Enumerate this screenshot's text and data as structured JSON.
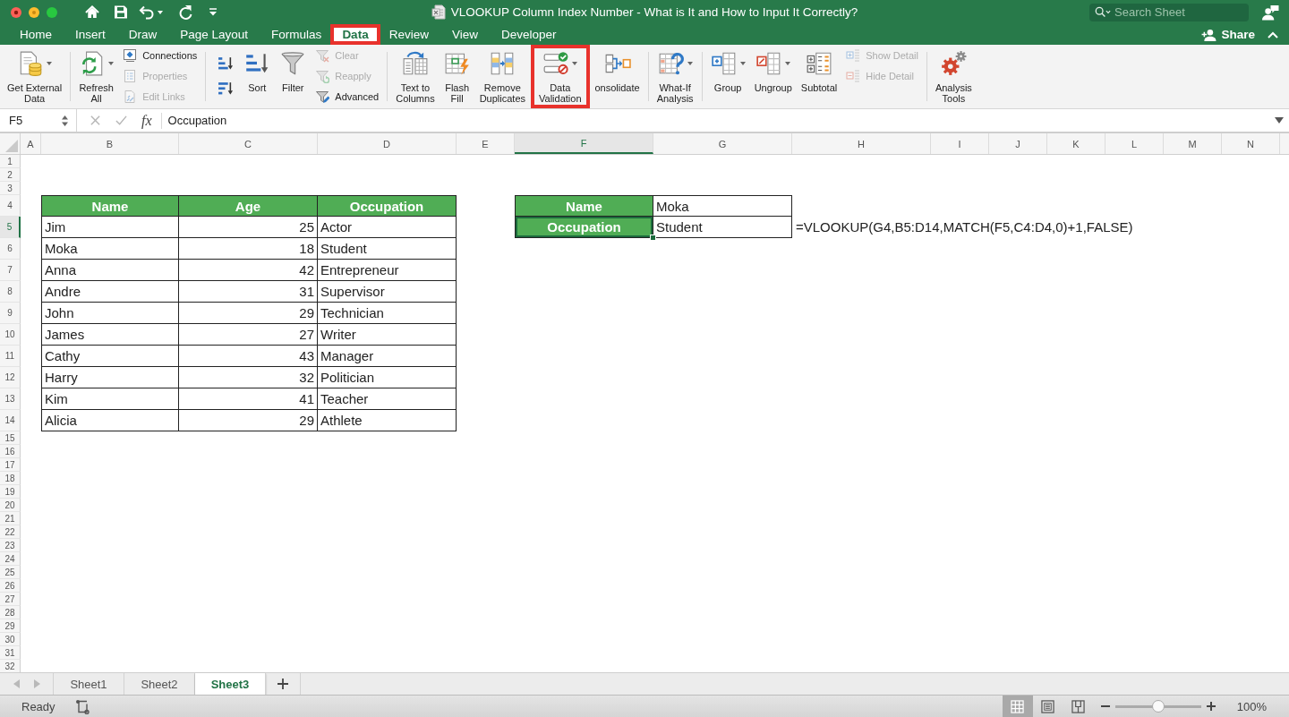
{
  "window": {
    "title": "VLOOKUP Column Index Number - What is It and How to Input It Correctly?"
  },
  "search": {
    "placeholder": "Search Sheet"
  },
  "ribbon_tabs": [
    {
      "label": "Home",
      "selected": false,
      "highlighted": false
    },
    {
      "label": "Insert",
      "selected": false,
      "highlighted": false
    },
    {
      "label": "Draw",
      "selected": false,
      "highlighted": false
    },
    {
      "label": "Page Layout",
      "selected": false,
      "highlighted": false
    },
    {
      "label": "Formulas",
      "selected": false,
      "highlighted": false
    },
    {
      "label": "Data",
      "selected": true,
      "highlighted": true
    },
    {
      "label": "Review",
      "selected": false,
      "highlighted": false
    },
    {
      "label": "View",
      "selected": false,
      "highlighted": false
    },
    {
      "label": "Developer",
      "selected": false,
      "highlighted": false
    }
  ],
  "share": {
    "label": "Share"
  },
  "ribbon_groups": [
    {
      "items": [
        {
          "kind": "large",
          "label": "Get External\nData",
          "dropdown": true,
          "highlighted": false
        }
      ]
    },
    {
      "items": [
        {
          "kind": "large",
          "label": "Refresh\nAll",
          "dropdown": true,
          "highlighted": false
        },
        {
          "kind": "stack",
          "buttons": [
            {
              "label": "Connections",
              "disabled": false
            },
            {
              "label": "Properties",
              "disabled": true
            },
            {
              "label": "Edit Links",
              "disabled": true
            }
          ]
        }
      ]
    },
    {
      "items": [
        {
          "kind": "sort_pair"
        },
        {
          "kind": "large",
          "label": "Sort",
          "dropdown": false,
          "highlighted": false
        },
        {
          "kind": "large",
          "label": "Filter",
          "dropdown": false,
          "highlighted": false
        },
        {
          "kind": "stack",
          "buttons": [
            {
              "label": "Clear",
              "disabled": true
            },
            {
              "label": "Reapply",
              "disabled": true
            },
            {
              "label": "Advanced",
              "disabled": false
            }
          ]
        }
      ]
    },
    {
      "items": [
        {
          "kind": "large",
          "label": "Text to\nColumns",
          "dropdown": false,
          "highlighted": false
        },
        {
          "kind": "large",
          "label": "Flash\nFill",
          "dropdown": false,
          "highlighted": false
        },
        {
          "kind": "large",
          "label": "Remove\nDuplicates",
          "dropdown": false,
          "highlighted": false
        },
        {
          "kind": "large",
          "label": "Data\nValidation",
          "dropdown": true,
          "highlighted": true
        },
        {
          "kind": "large",
          "label": "onsolidate",
          "dropdown": false,
          "highlighted": false
        }
      ]
    },
    {
      "items": [
        {
          "kind": "large",
          "label": "What-If\nAnalysis",
          "dropdown": true,
          "highlighted": false
        }
      ]
    },
    {
      "items": [
        {
          "kind": "large",
          "label": "Group",
          "dropdown": true,
          "highlighted": false
        },
        {
          "kind": "large",
          "label": "Ungroup",
          "dropdown": true,
          "highlighted": false
        },
        {
          "kind": "large",
          "label": "Subtotal",
          "dropdown": false,
          "highlighted": false
        },
        {
          "kind": "stack",
          "buttons": [
            {
              "label": "Show Detail",
              "disabled": true
            },
            {
              "label": "Hide Detail",
              "disabled": true
            }
          ]
        }
      ]
    },
    {
      "items": [
        {
          "kind": "large",
          "label": "Analysis\nTools",
          "dropdown": false,
          "highlighted": false
        }
      ]
    }
  ],
  "formula_bar": {
    "name_box": "F5",
    "function_label": "fx",
    "value": "Occupation"
  },
  "columns": [
    {
      "label": "A",
      "selected": false
    },
    {
      "label": "B",
      "selected": false
    },
    {
      "label": "C",
      "selected": false
    },
    {
      "label": "D",
      "selected": false
    },
    {
      "label": "E",
      "selected": false
    },
    {
      "label": "F",
      "selected": true
    },
    {
      "label": "G",
      "selected": false
    },
    {
      "label": "H",
      "selected": false
    },
    {
      "label": "I",
      "selected": false
    },
    {
      "label": "J",
      "selected": false
    },
    {
      "label": "K",
      "selected": false
    },
    {
      "label": "L",
      "selected": false
    },
    {
      "label": "M",
      "selected": false
    },
    {
      "label": "N",
      "selected": false
    }
  ],
  "rows": [
    {
      "label": "1",
      "selected": false
    },
    {
      "label": "2",
      "selected": false
    },
    {
      "label": "3",
      "selected": false
    },
    {
      "label": "4",
      "selected": false
    },
    {
      "label": "5",
      "selected": true
    },
    {
      "label": "6",
      "selected": false
    },
    {
      "label": "7",
      "selected": false
    },
    {
      "label": "8",
      "selected": false
    },
    {
      "label": "9",
      "selected": false
    },
    {
      "label": "10",
      "selected": false
    },
    {
      "label": "11",
      "selected": false
    },
    {
      "label": "12",
      "selected": false
    },
    {
      "label": "13",
      "selected": false
    },
    {
      "label": "14",
      "selected": false
    },
    {
      "label": "15",
      "selected": false
    },
    {
      "label": "16",
      "selected": false
    },
    {
      "label": "17",
      "selected": false
    },
    {
      "label": "18",
      "selected": false
    },
    {
      "label": "19",
      "selected": false
    },
    {
      "label": "20",
      "selected": false
    },
    {
      "label": "21",
      "selected": false
    },
    {
      "label": "22",
      "selected": false
    },
    {
      "label": "23",
      "selected": false
    },
    {
      "label": "24",
      "selected": false
    },
    {
      "label": "25",
      "selected": false
    },
    {
      "label": "26",
      "selected": false
    },
    {
      "label": "27",
      "selected": false
    },
    {
      "label": "28",
      "selected": false
    },
    {
      "label": "29",
      "selected": false
    },
    {
      "label": "30",
      "selected": false
    },
    {
      "label": "31",
      "selected": false
    },
    {
      "label": "32",
      "selected": false
    }
  ],
  "table": {
    "columns": [
      {
        "label": "Name",
        "numeric": false
      },
      {
        "label": "Age",
        "numeric": true
      },
      {
        "label": "Occupation",
        "numeric": false
      }
    ],
    "rows": [
      [
        "Jim",
        "25",
        "Actor"
      ],
      [
        "Moka",
        "18",
        "Student"
      ],
      [
        "Anna",
        "42",
        "Entrepreneur"
      ],
      [
        "Andre",
        "31",
        "Supervisor"
      ],
      [
        "John",
        "29",
        "Technician"
      ],
      [
        "James",
        "27",
        "Writer"
      ],
      [
        "Cathy",
        "43",
        "Manager"
      ],
      [
        "Harry",
        "32",
        "Politician"
      ],
      [
        "Kim",
        "41",
        "Teacher"
      ],
      [
        "Alicia",
        "29",
        "Athlete"
      ]
    ]
  },
  "lookup": {
    "rows": [
      {
        "label": "Name",
        "value": "Moka",
        "selected": false
      },
      {
        "label": "Occupation",
        "value": "Student",
        "selected": true,
        "formula": "=VLOOKUP(G4,B5:D14,MATCH(F5,C4:D4,0)+1,FALSE)"
      }
    ]
  },
  "sheet_tabs": [
    {
      "label": "Sheet1",
      "selected": false
    },
    {
      "label": "Sheet2",
      "selected": false
    },
    {
      "label": "Sheet3",
      "selected": true
    }
  ],
  "status_bar": {
    "status": "Ready",
    "views": [
      {
        "selected": true
      },
      {
        "selected": false
      },
      {
        "selected": false
      }
    ],
    "zoom": {
      "level": 0.5,
      "reading": "100%"
    }
  }
}
